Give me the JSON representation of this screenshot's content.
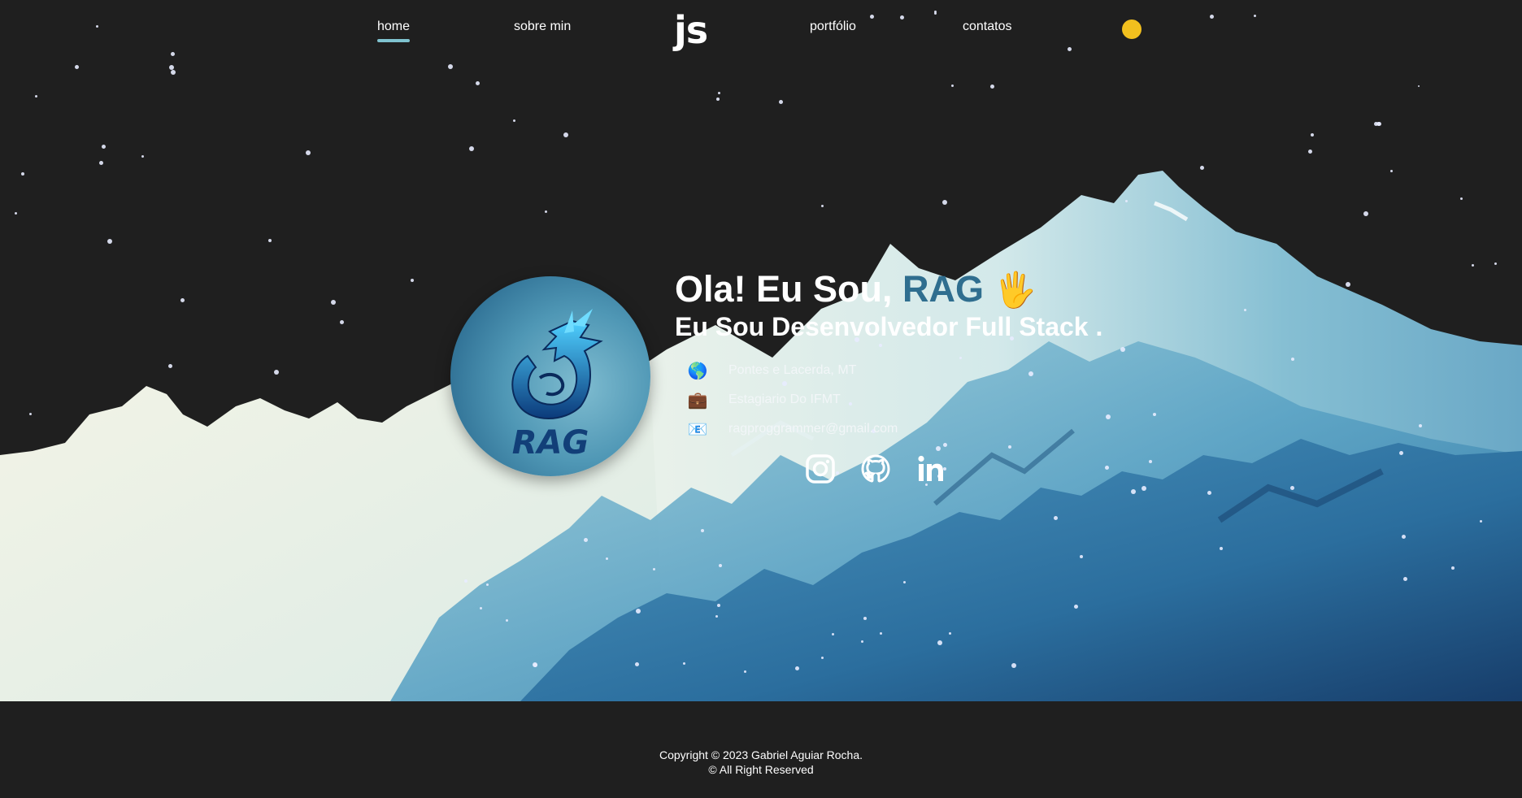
{
  "nav": {
    "items": [
      {
        "label": "home",
        "active": true
      },
      {
        "label": "sobre min"
      },
      {
        "label": "portfólio"
      },
      {
        "label": "contatos"
      }
    ],
    "logo": "js",
    "theme_toggle_color": "#f2c01e"
  },
  "hero": {
    "greeting": "Ola! Eu Sou, ",
    "name": "RAG",
    "wave_emoji": "🖐",
    "subtitle": "Eu Sou Desenvolvedor Full Stack .",
    "avatar_text": "RAG",
    "info": [
      {
        "icon": "globe-icon",
        "glyph": "🌎",
        "text": "Pontes e Lacerda, MT"
      },
      {
        "icon": "briefcase-icon",
        "glyph": "💼",
        "text": "Estagiario Do IFMT"
      },
      {
        "icon": "email-icon",
        "glyph": "📧",
        "text": "ragproggrammer@gmail.com"
      }
    ],
    "socials": [
      {
        "icon": "instagram-icon"
      },
      {
        "icon": "github-icon"
      },
      {
        "icon": "linkedin-icon"
      }
    ],
    "accent_color": "#2f6e8f"
  },
  "footer": {
    "line1": "Copyright © 2023 Gabriel Aguiar Rocha.",
    "line2": "© All Right Reserved"
  }
}
